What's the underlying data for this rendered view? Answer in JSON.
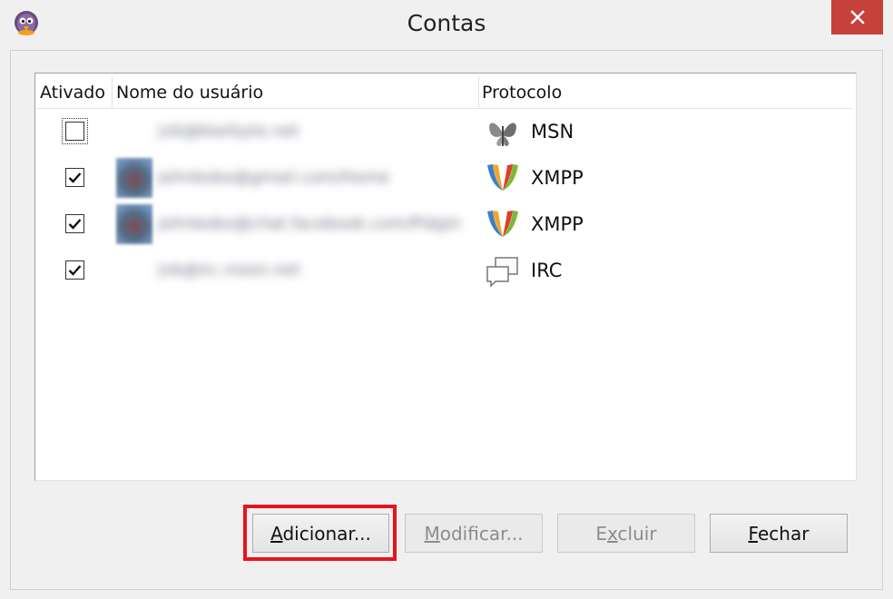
{
  "window": {
    "title": "Contas",
    "close_label": "✕"
  },
  "columns": {
    "enabled": "Ativado",
    "username": "Nome do usuário",
    "protocol": "Protocolo"
  },
  "accounts": [
    {
      "enabled": false,
      "username": "jvb@blarbyte.net",
      "protocol": "MSN",
      "has_avatar": false
    },
    {
      "enabled": true,
      "username": "johnbobo@gmail.com/Home",
      "protocol": "XMPP",
      "has_avatar": true
    },
    {
      "enabled": true,
      "username": "johnbobo@chat.facebook.com/Pidgin",
      "protocol": "XMPP",
      "has_avatar": true
    },
    {
      "enabled": true,
      "username": "jvb@irc.nixon.net",
      "protocol": "IRC",
      "has_avatar": false
    }
  ],
  "buttons": {
    "add": {
      "accel": "A",
      "rest": "dicionar...",
      "enabled": true
    },
    "modify": {
      "accel": "M",
      "rest": "odificar...",
      "enabled": false
    },
    "delete_pre": "E",
    "delete_accel": "x",
    "delete_rest": "cluir",
    "delete_enabled": false,
    "close": {
      "accel": "F",
      "rest": "echar",
      "enabled": true
    }
  },
  "colors": {
    "highlight": "#e8141b",
    "close_button": "#c7413b"
  }
}
